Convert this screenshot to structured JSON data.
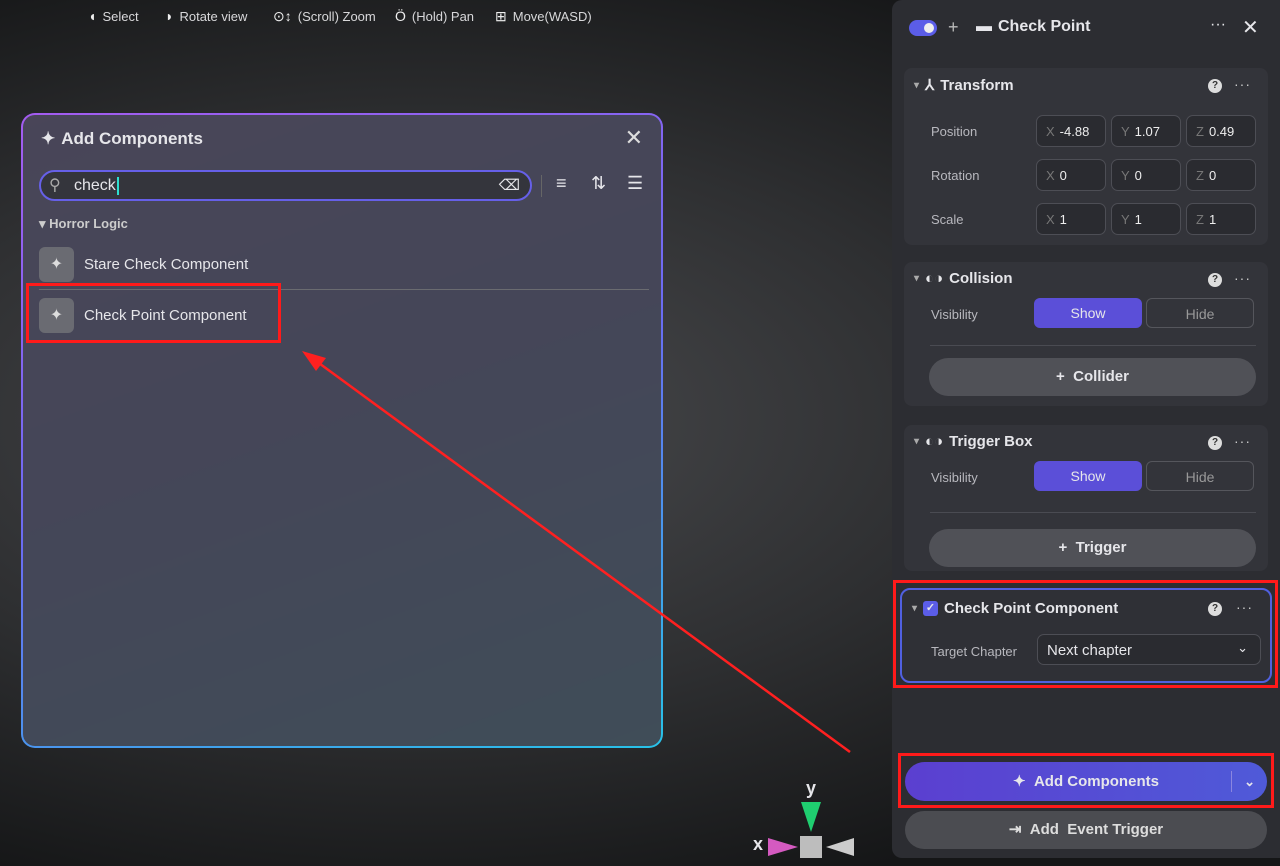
{
  "hints": [
    {
      "icon": "mouse-left-icon",
      "label": "Select"
    },
    {
      "icon": "mouse-right-icon",
      "label": "Rotate view"
    },
    {
      "icon": "mouse-scroll-icon",
      "label": "(Scroll) Zoom"
    },
    {
      "icon": "mouse-middle-icon",
      "label": "(Hold) Pan"
    },
    {
      "icon": "keys-icon",
      "label": "Move(WASD)"
    }
  ],
  "dialog": {
    "title": "Add Components",
    "search_value": "check",
    "category": "Horror Logic",
    "items": [
      "Stare Check Component",
      "Check Point Component"
    ]
  },
  "panel": {
    "title": "Check Point",
    "transform": {
      "title": "Transform",
      "rows": [
        {
          "label": "Position",
          "x": "-4.88",
          "y": "1.07",
          "z": "0.49"
        },
        {
          "label": "Rotation",
          "x": "0",
          "y": "0",
          "z": "0"
        },
        {
          "label": "Scale",
          "x": "1",
          "y": "1",
          "z": "1"
        }
      ]
    },
    "collision": {
      "title": "Collision",
      "visibility": "Visibility",
      "show": "Show",
      "hide": "Hide",
      "add": "Collider"
    },
    "trigger": {
      "title": "Trigger Box",
      "visibility": "Visibility",
      "show": "Show",
      "hide": "Hide",
      "add": "Trigger"
    },
    "checkpoint": {
      "title": "Check Point Component",
      "field": "Target Chapter",
      "value": "Next chapter"
    },
    "add_components": "Add Components",
    "add_event": "Add  Event Trigger"
  },
  "gizmo": {
    "x": "x",
    "y": "y"
  },
  "colors": {
    "accent": "#5b4fd8",
    "highlight": "#ff1a1a"
  }
}
